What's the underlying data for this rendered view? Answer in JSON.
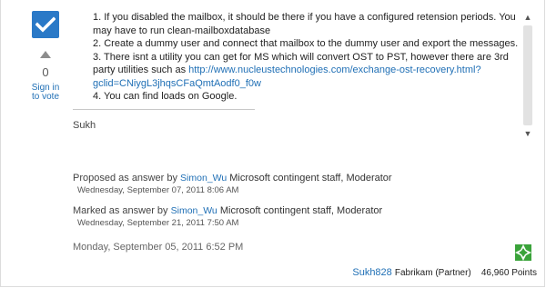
{
  "vote": {
    "count": "0",
    "sign_in_label_line1": "Sign in",
    "sign_in_label_line2": "to vote"
  },
  "answer": {
    "items": [
      "1. If you disabled the mailbox, it should be there if you have a configured retension periods. You may have to run clean-mailboxdatabase",
      "2. Create a dummy user and connect that mailbox to the dummy user and export the messages.",
      "3. There isnt a utility you can get for MS which will convert OST to PST, however there are 3rd party utilities such as",
      "4. You can find loads on Google."
    ],
    "item3_link": "http://www.nucleustechnologies.com/exchange-ost-recovery.html?gclid=CNiygL3jhqsCFaQmtAodf0_f0w",
    "signature": "Sukh"
  },
  "proposed": {
    "prefix": "Proposed as answer by",
    "user": "Simon_Wu",
    "role": "Microsoft contingent staff, Moderator",
    "date": "Wednesday, September 07, 2011 8:06 AM"
  },
  "marked": {
    "prefix": "Marked as answer by",
    "user": "Simon_Wu",
    "role": "Microsoft contingent staff, Moderator",
    "date": "Wednesday, September 21, 2011 7:50 AM"
  },
  "post_date": "Monday, September 05, 2011 6:52 PM",
  "author": {
    "name": "Sukh828",
    "org": "Fabrikam (Partner)",
    "points": "46,960 Points"
  },
  "colors": {
    "accent": "#2a79c7",
    "link": "#1f6fb5",
    "rank_icon": "#3aa33a"
  },
  "icons": {
    "answer": "checkmark-icon",
    "vote": "arrow-up-icon",
    "rank": "rank-icon"
  }
}
